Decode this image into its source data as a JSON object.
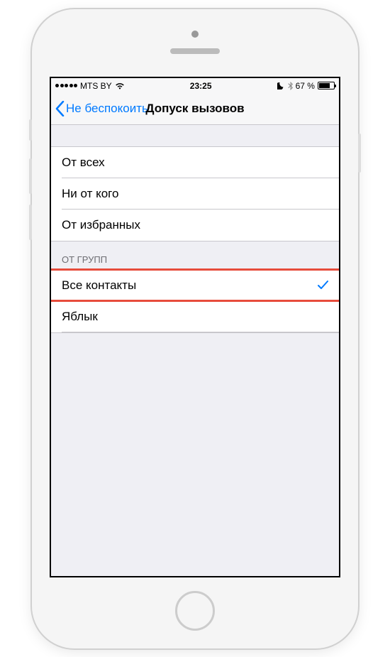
{
  "status": {
    "carrier": "MTS BY",
    "time": "23:25",
    "battery": "67 %"
  },
  "nav": {
    "back_label": "Не беспокоить",
    "title": "Допуск вызовов"
  },
  "group1": {
    "items": [
      {
        "label": "От всех",
        "selected": false
      },
      {
        "label": "Ни от кого",
        "selected": false
      },
      {
        "label": "От избранных",
        "selected": false
      }
    ]
  },
  "group2": {
    "header": "ОТ ГРУПП",
    "items": [
      {
        "label": "Все контакты",
        "selected": true
      },
      {
        "label": "Яблык",
        "selected": false
      }
    ]
  }
}
